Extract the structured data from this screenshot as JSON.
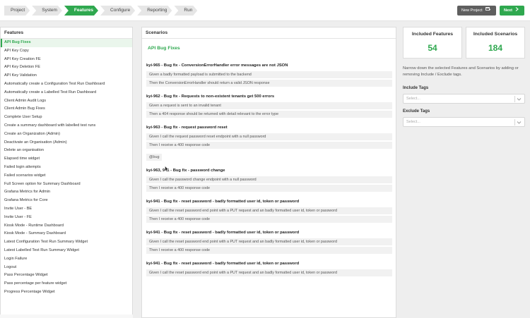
{
  "breadcrumbs": [
    "Project",
    "System",
    "Features",
    "Configure",
    "Reporting",
    "Run"
  ],
  "active_breadcrumb_index": 2,
  "buttons": {
    "new_project": "New Project",
    "next": "Next"
  },
  "features_panel": {
    "title": "Features",
    "items": [
      "API Bug Fixes",
      "API Key Copy",
      "API Key Creation FE",
      "API Key Deletion FE",
      "API Key Validation",
      "Automatically create a Configuration Test Run Dashboard",
      "Automatically create a Labelled Test Run Dashboard",
      "Client Admin Audit Logs",
      "Client Admin Bug Fixes",
      "Complete User Setup",
      "Create a summary dashboard with labelled test runs",
      "Create an Organization (Admin)",
      "Deactivate an Organisation (Admin)",
      "Delete an organisation",
      "Elapsed time widget",
      "Failed login attempts",
      "Failed scenarios widget",
      "Full Screen option for Summary Dashboard",
      "Grafana Metrics for Admin",
      "Grafana Metrics for Core",
      "Invite User - BE",
      "Invite User - FE",
      "Kiosk Mode - Runtime Dashboard",
      "Kiosk Mode - Summary Dashboard",
      "Latest Configuration Test Run Summary Widget",
      "Latest Labelled Test Run Summary Widget",
      "Login Failure",
      "Logout",
      "Pass Percentage Widget",
      "Pass percentage per feature widget",
      "Progress Percentage Widget"
    ],
    "selected_index": 0
  },
  "scenarios_panel": {
    "title": "Scenarios",
    "feature_title": "API Bug Fixes",
    "scenarios": [
      {
        "name": "kyi-965 - Bug fix - ConversionErrorHandler error messages are not JSON",
        "steps": [
          "Given a badly formatted payload is submitted to the backend",
          "Then the ConversionErrorHandler should return a valid JSON response"
        ]
      },
      {
        "name": "kyi-962 - Bug fix - Requests to non-existent tenants get 500 errors",
        "steps": [
          "Given a request is sent to an invalid tenant",
          "Then a 404 response should be returned with detail relevant to the error type"
        ]
      },
      {
        "name": "kyi-963 - Bug fix - request password reset",
        "steps": [
          "Given I call the request password reset endpoint with a null password",
          "Then I receive a 400 response code"
        ],
        "tag": "@bug"
      },
      {
        "name": "kyi-963, 941 - Bug fix - password change",
        "steps": [
          "Given I call the password change endpoint with a null password",
          "Then I receive a 400 response code"
        ]
      },
      {
        "name": "kyi-941 - Bug fix - reset password - badly formatted user id, token or password",
        "steps": [
          "Given I call the reset password end point with a PUT request and an badly formatted user id, token or password",
          "Then I receive a 400 response code"
        ]
      },
      {
        "name": "kyi-941 - Bug fix - reset password - badly formatted user id, token or password",
        "steps": [
          "Given I call the reset password end point with a PUT request and an badly formatted user id, token or password",
          "Then I receive a 400 response code"
        ]
      },
      {
        "name": "kyi-941 - Bug fix - reset password - badly formatted user id, token or password",
        "steps": [
          "Given I call the reset password end point with a PUT request and an badly formatted user id, token or password"
        ]
      }
    ]
  },
  "stats": {
    "included_features_label": "Included Features",
    "included_features_value": "54",
    "included_scenarios_label": "Included Scenarios",
    "included_scenarios_value": "184"
  },
  "filter_description": "Narrow down the selected Features and Scenarios by adding or removing Include / Exclude tags.",
  "include_tags": {
    "label": "Include Tags",
    "placeholder": "Select..."
  },
  "exclude_tags": {
    "label": "Exclude Tags",
    "placeholder": "Select..."
  },
  "colors": {
    "accent": "#2fa84f",
    "dark_button": "#5f5f5f"
  },
  "icons": {
    "new_project": "window-plus-icon",
    "next": "chevron-right-icon",
    "select": "chevron-down-icon"
  }
}
